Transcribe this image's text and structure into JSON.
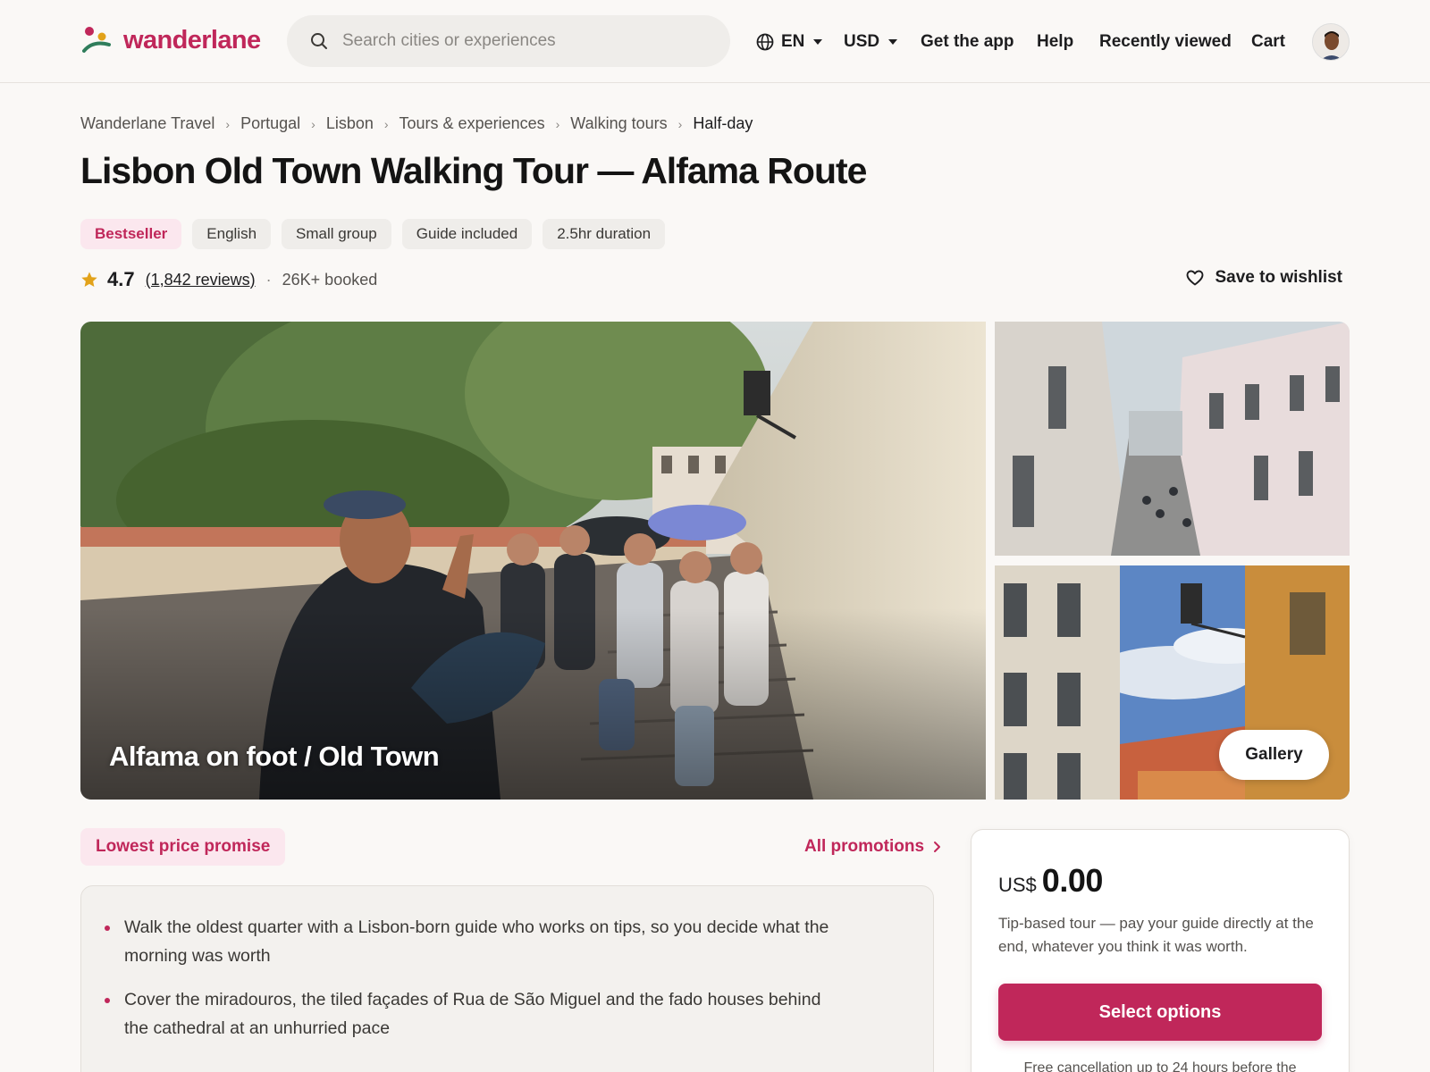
{
  "brand": {
    "name": "wanderlane",
    "color": "#c0275a"
  },
  "search": {
    "placeholder": "Search cities or experiences"
  },
  "nav": {
    "language": "EN",
    "currency": "USD",
    "links": [
      "Get the app",
      "Help",
      "Recently viewed",
      "Cart"
    ]
  },
  "breadcrumb": [
    "Wanderlane Travel",
    "Portugal",
    "Lisbon",
    "Tours & experiences",
    "Walking tours",
    "Half-day"
  ],
  "title": "Lisbon Old Town Walking Tour — Alfama Route",
  "tags": [
    "Bestseller",
    "English",
    "Small group",
    "Guide included",
    "2.5hr duration"
  ],
  "rating": {
    "value": "4.7",
    "reviews": "(1,842 reviews)",
    "booked": "26K+ booked",
    "stars_color": "#e2a21a"
  },
  "wishlist_label": "Save to wishlist",
  "gallery": {
    "hero_caption": "Alfama on foot / Old Town",
    "button_label": "Gallery"
  },
  "promotions": {
    "promise": "Lowest price promise",
    "all_label": "All promotions"
  },
  "highlights": [
    "Walk the oldest quarter with a Lisbon-born guide who works on tips, so you decide what the morning was worth",
    "Cover the miradouros, the tiled façades of Rua de São Miguel and the fado houses behind the cathedral at an unhurried pace"
  ],
  "price": {
    "currency": "US$",
    "amount": "0.00",
    "note": "Tip-based tour — pay your guide directly at the end, whatever you think it was worth.",
    "cta": "Select options",
    "cancellation": "Free cancellation up to 24 hours before the"
  }
}
